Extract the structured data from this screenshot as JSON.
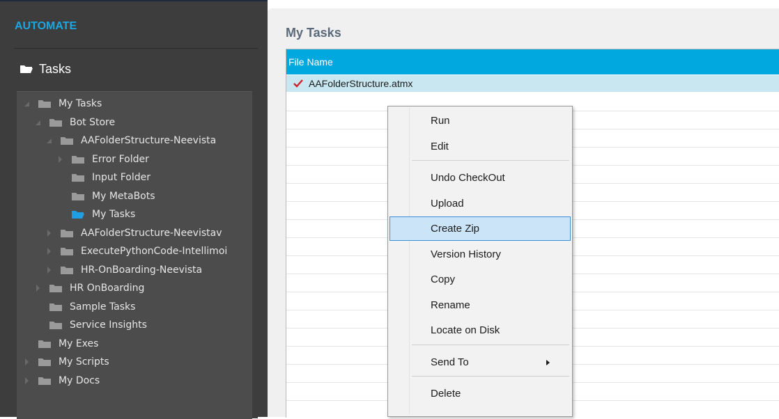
{
  "sidebar": {
    "brand": "AUTOMATE",
    "tasks_header": "Tasks",
    "tree": [
      {
        "label": "My Tasks",
        "level": 0,
        "expander": "expanded",
        "selected": false
      },
      {
        "label": "Bot Store",
        "level": 1,
        "expander": "expanded",
        "selected": false
      },
      {
        "label": "AAFolderStructure-Neevista",
        "level": 2,
        "expander": "expanded",
        "selected": false
      },
      {
        "label": "Error Folder",
        "level": 3,
        "expander": "collapsed",
        "selected": false
      },
      {
        "label": "Input Folder",
        "level": 3,
        "expander": "none",
        "selected": false
      },
      {
        "label": "My MetaBots",
        "level": 3,
        "expander": "none",
        "selected": false
      },
      {
        "label": "My Tasks",
        "level": 3,
        "expander": "none",
        "selected": true
      },
      {
        "label": "AAFolderStructure-Neevistav",
        "level": 2,
        "expander": "collapsed",
        "selected": false
      },
      {
        "label": "ExecutePythonCode-Intellimoi",
        "level": 2,
        "expander": "collapsed",
        "selected": false
      },
      {
        "label": "HR-OnBoarding-Neevista",
        "level": 2,
        "expander": "collapsed",
        "selected": false
      },
      {
        "label": "HR OnBoarding",
        "level": 1,
        "expander": "collapsed",
        "selected": false
      },
      {
        "label": "Sample Tasks",
        "level": 1,
        "expander": "none",
        "selected": false
      },
      {
        "label": "Service Insights",
        "level": 1,
        "expander": "none",
        "selected": false
      },
      {
        "label": "My Exes",
        "level": 0,
        "expander": "none",
        "selected": false
      },
      {
        "label": "My Scripts",
        "level": 0,
        "expander": "collapsed",
        "selected": false
      },
      {
        "label": "My Docs",
        "level": 0,
        "expander": "collapsed",
        "selected": false
      }
    ]
  },
  "main": {
    "title": "My Tasks",
    "grid": {
      "columns": [
        "File Name"
      ],
      "rows": [
        {
          "file_name": "AAFolderStructure.atmx",
          "checked": true,
          "icon": "checkmark-icon"
        }
      ]
    }
  },
  "context_menu": {
    "items": [
      {
        "label": "Run",
        "highlighted": false,
        "separator_after": false
      },
      {
        "label": "Edit",
        "highlighted": false,
        "separator_after": true
      },
      {
        "label": "Undo CheckOut",
        "highlighted": false,
        "separator_after": false
      },
      {
        "label": "Upload",
        "highlighted": false,
        "separator_after": false
      },
      {
        "label": "Create Zip",
        "highlighted": true,
        "separator_after": false
      },
      {
        "label": "Version History",
        "highlighted": false,
        "separator_after": false
      },
      {
        "label": "Copy",
        "highlighted": false,
        "separator_after": false
      },
      {
        "label": "Rename",
        "highlighted": false,
        "separator_after": false
      },
      {
        "label": "Locate on Disk",
        "highlighted": false,
        "separator_after": true
      },
      {
        "label": "Send To",
        "highlighted": false,
        "separator_after": true,
        "submenu": true
      },
      {
        "label": "Delete",
        "highlighted": false,
        "separator_after": false
      }
    ]
  },
  "colors": {
    "accent_blue": "#00a8e0",
    "brand_blue": "#1aa7e2",
    "selected_row": "#c9e7f1",
    "menu_highlight": "#cce4f7",
    "check_red": "#d0202a",
    "folder_gray": "#9a9a9a",
    "folder_selected": "#1e9fe6"
  }
}
